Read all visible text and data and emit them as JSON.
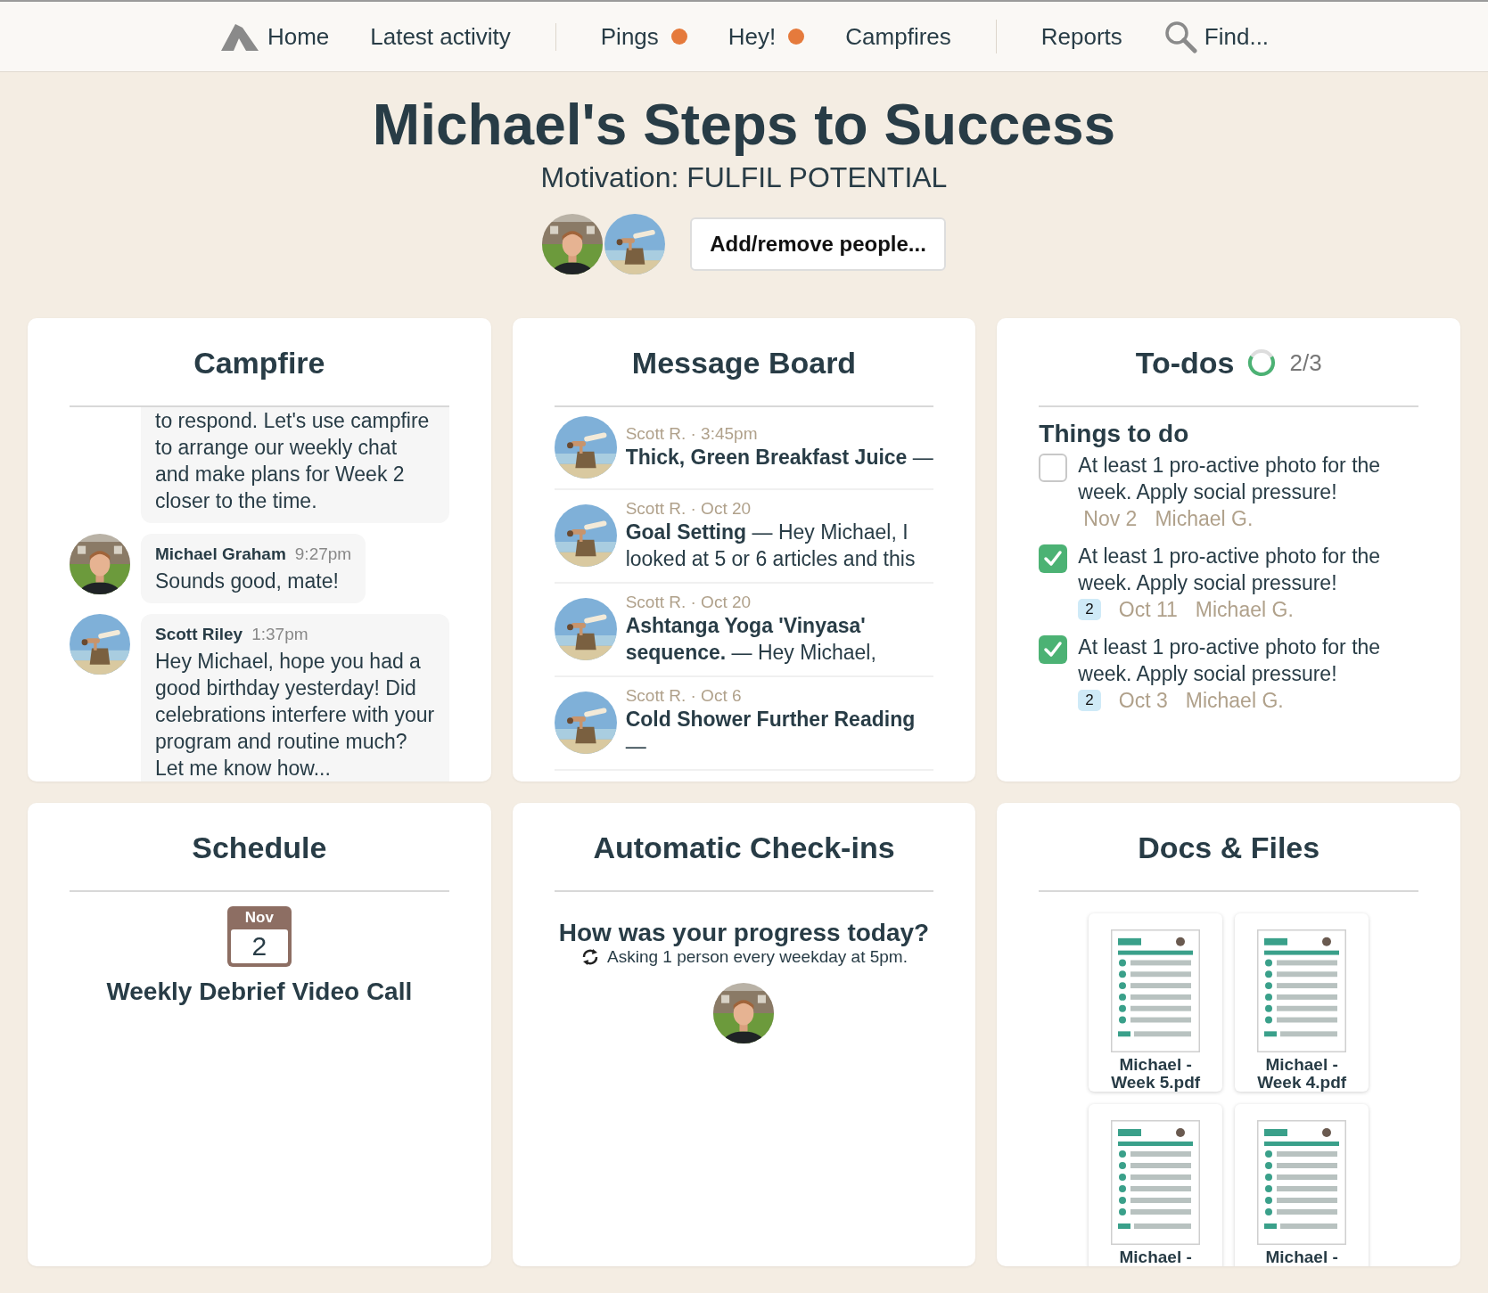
{
  "nav": {
    "groups": [
      [
        {
          "label": "Home",
          "kind": "home",
          "unread": false
        },
        {
          "label": "Latest activity",
          "kind": "link",
          "unread": false
        }
      ],
      [
        {
          "label": "Pings",
          "kind": "link",
          "unread": true
        },
        {
          "label": "Hey!",
          "kind": "link",
          "unread": true
        },
        {
          "label": "Campfires",
          "kind": "link",
          "unread": false
        }
      ],
      [
        {
          "label": "Reports",
          "kind": "link",
          "unread": false
        },
        {
          "label": "Find...",
          "kind": "search",
          "unread": false
        }
      ]
    ]
  },
  "header": {
    "title": "Michael's Steps to Success",
    "subtitle": "Motivation: FULFIL POTENTIAL",
    "button": "Add/remove people..."
  },
  "campfire": {
    "title": "Campfire",
    "messages": [
      {
        "text": "to respond. Let's use campfire to arrange our weekly chat and make plans for Week 2 closer to the time."
      },
      {
        "author": "Michael Graham",
        "time": "9:27pm",
        "text": "Sounds good, mate!"
      },
      {
        "author": "Scott Riley",
        "time": "1:37pm",
        "text": "Hey Michael, hope you had a good birthday yesterday! Did celebrations interfere with your program and routine much? Let me know how..."
      }
    ]
  },
  "message_board": {
    "title": "Message Board",
    "posts": [
      {
        "meta": "Scott R. · 3:45pm",
        "text": "**Thick, Green Breakfast Juice** —"
      },
      {
        "meta": "Scott R. · Oct 20",
        "text": "**Goal Setting** — Hey Michael, I looked at 5 or 6 articles and this"
      },
      {
        "meta": "Scott R. · Oct 20",
        "text": "**Ashtanga Yoga 'Vinyasa' sequence.** — Hey Michael,"
      },
      {
        "meta": "Scott R. · Oct 6",
        "text": "**Cold Shower Further Reading** —"
      }
    ]
  },
  "todos": {
    "title": "To-dos",
    "progress": {
      "level": 0.667,
      "text": "2/3"
    },
    "list_title": "Things to do",
    "items": [
      {
        "checked": false,
        "text": "At least 1 pro-active photo for the week. Apply social pressure!",
        "due": "Nov 2",
        "assignee": "Michael G."
      },
      {
        "checked": true,
        "text": "At least 1 pro-active photo for the week. Apply social pressure!",
        "comments": "2",
        "due": "Oct 11",
        "assignee": "Michael G."
      },
      {
        "checked": true,
        "text": "At least 1 pro-active photo for the week. Apply social pressure!",
        "comments": "2",
        "due": "Oct 3",
        "assignee": "Michael G."
      }
    ]
  },
  "schedule": {
    "title": "Schedule",
    "event": {
      "month": "Nov",
      "day": "2",
      "title": "Weekly Debrief Video Call"
    }
  },
  "checkins": {
    "title": "Automatic Check-ins",
    "question": "How was your progress today?",
    "detail": "Asking 1 person every weekday at 5pm."
  },
  "docs": {
    "title": "Docs & Files",
    "files": [
      {
        "name": "Michael - Week 5.pdf"
      },
      {
        "name": "Michael - Week 4.pdf"
      },
      {
        "name": "Michael -"
      },
      {
        "name": "Michael -"
      }
    ]
  }
}
